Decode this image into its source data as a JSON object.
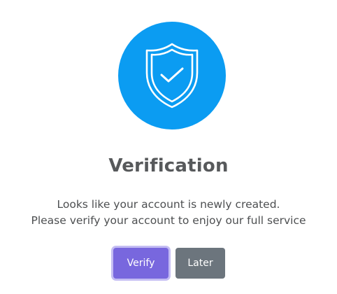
{
  "dialog": {
    "icon": "shield-check-icon",
    "icon_color": "#0b9cf2",
    "title": "Verification",
    "message_line1": "Looks like your account is newly created.",
    "message_line2": "Please verify your account to enjoy our full service",
    "buttons": {
      "verify_label": "Verify",
      "later_label": "Later"
    },
    "colors": {
      "verify_button": "#7867de",
      "later_button": "#6c757d"
    }
  }
}
